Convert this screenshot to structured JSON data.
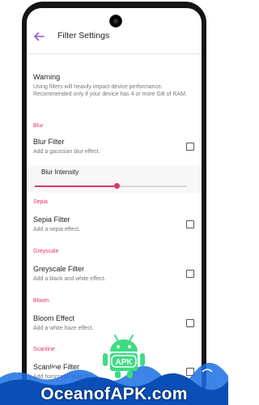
{
  "appbar": {
    "title": "Filter Settings",
    "back_icon": "arrow-back-icon"
  },
  "warning": {
    "title": "Warning",
    "subtitle": "Using filters will heavily impact device performance. Recommended only if your device has 4 or more GB of RAM."
  },
  "blur": {
    "category": "Blur",
    "title": "Blur Filter",
    "subtitle": "Add a gaussian blur effect.",
    "checked": false,
    "intensity_label": "Blur Intensity",
    "intensity_fraction": 0.54
  },
  "sepia": {
    "category": "Sepia",
    "title": "Sepia Filter",
    "subtitle": "Add a sepia effect.",
    "checked": false
  },
  "greyscale": {
    "category": "Greyscale",
    "title": "Greyscale Filter",
    "subtitle": "Add a black and white effect.",
    "checked": false
  },
  "bloom": {
    "category": "Bloom",
    "title": "Bloom Effect",
    "subtitle": "Add a white haze effect.",
    "checked": false
  },
  "scanline": {
    "category": "Scanline",
    "title": "Scanline Filter",
    "subtitle": "Add horizontal scan lin",
    "checked": false
  },
  "watermark": {
    "text": "OceanofAPK.com",
    "logo_text": "APK"
  },
  "colors": {
    "accent": "#e0336e",
    "accent_purple": "#8b5cc9",
    "watermark_blue": "#0a5fd0"
  }
}
